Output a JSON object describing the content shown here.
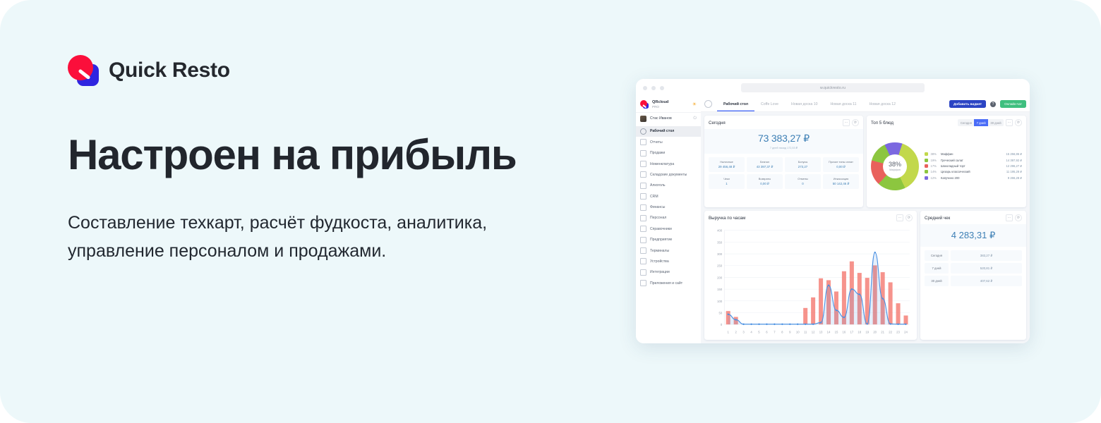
{
  "brand": {
    "name": "Quick Resto"
  },
  "hero": {
    "headline": "Настроен на прибыль",
    "subhead": "Составление техкарт, расчёт фудкоста, аналитика, управление персоналом и продажами."
  },
  "browser": {
    "url": "w.quickresto.ru"
  },
  "app": {
    "sidebar": {
      "brand_name": "QRcloud",
      "brand_plan": "PRO",
      "user": "Стас Иванов",
      "items": [
        {
          "label": "Рабочий стол",
          "icon": "desktop-icon",
          "active": true
        },
        {
          "label": "Отчеты",
          "icon": "report-icon",
          "active": false
        },
        {
          "label": "Продажи",
          "icon": "sales-icon",
          "active": false
        },
        {
          "label": "Номенклатура",
          "icon": "nomenclature-icon",
          "active": false
        },
        {
          "label": "Складские документы",
          "icon": "warehouse-icon",
          "active": false
        },
        {
          "label": "Алкоголь",
          "icon": "alcohol-icon",
          "active": false
        },
        {
          "label": "CRM",
          "icon": "crm-icon",
          "active": false
        },
        {
          "label": "Финансы",
          "icon": "finance-icon",
          "active": false
        },
        {
          "label": "Персонал",
          "icon": "staff-icon",
          "active": false
        },
        {
          "label": "Справочники",
          "icon": "directory-icon",
          "active": false
        },
        {
          "label": "Предприятие",
          "icon": "enterprise-icon",
          "active": false
        },
        {
          "label": "Терминалы",
          "icon": "terminal-icon",
          "active": false
        },
        {
          "label": "Устройства",
          "icon": "device-icon",
          "active": false
        },
        {
          "label": "Интеграции",
          "icon": "integration-icon",
          "active": false
        },
        {
          "label": "Приложения и сайт",
          "icon": "apps-icon",
          "active": false
        }
      ]
    },
    "topbar": {
      "tabs": [
        {
          "label": "Рабочий стол",
          "active": true
        },
        {
          "label": "Coffe Love",
          "active": false
        },
        {
          "label": "Новая доска 10",
          "active": false
        },
        {
          "label": "Новая доска 11",
          "active": false
        },
        {
          "label": "Новая доска 12",
          "active": false
        }
      ],
      "add_widget": "Добавить виджет",
      "help": "?",
      "chat": "Онлайн-чат"
    },
    "today_card": {
      "title": "Сегодня",
      "total": "73 383,27 ₽",
      "compare": "7 дней назад 172,53 ₽",
      "metrics": [
        {
          "label": "Наличные",
          "value": "29 456,48 ₽"
        },
        {
          "label": "Безнал",
          "value": "43 397,37 ₽"
        },
        {
          "label": "Бонусы",
          "value": "273,27"
        },
        {
          "label": "Прочие типы оплат",
          "value": "0,00 ₽"
        },
        {
          "label": "Чеки",
          "value": "1"
        },
        {
          "label": "Возвраты",
          "value": "0,00 ₽"
        },
        {
          "label": "Отмены",
          "value": "0"
        },
        {
          "label": "Инкассация",
          "value": "50 142,46 ₽"
        }
      ]
    },
    "top5_card": {
      "title": "Топ 5 блюд",
      "periods": [
        {
          "label": "Сегодня",
          "active": false
        },
        {
          "label": "7 дней",
          "active": true
        },
        {
          "label": "30 дней",
          "active": false
        }
      ],
      "center_pct": "38%",
      "center_label": "Маффин"
    },
    "revenue_card": {
      "title": "Выручка по часам"
    },
    "avg_card": {
      "title": "Средний чек",
      "total": "4 283,31 ₽",
      "rows": [
        {
          "label": "Сегодня",
          "value": "383,27 ₽"
        },
        {
          "label": "7 дней",
          "value": "520,81 ₽"
        },
        {
          "label": "30 дней",
          "value": "407,62 ₽"
        }
      ]
    }
  },
  "chart_data": [
    {
      "type": "pie",
      "title": "Топ 5 блюд",
      "legend_position": "right",
      "labels": [
        "Маффин",
        "Греческий салат",
        "Шоколадный торт",
        "Цезарь классический",
        "Капучино 200"
      ],
      "values": [
        38,
        19,
        17,
        14,
        12
      ],
      "value_labels": [
        "38%",
        "19%",
        "17%",
        "14%",
        "12%"
      ],
      "amounts": [
        "15 256,86 ₽",
        "14 397,92 ₽",
        "12 296,27 ₽",
        "11 195,28 ₽",
        "9 266,28 ₽"
      ],
      "colors": [
        "#c2d84b",
        "#8cc63f",
        "#e9615c",
        "#8cc63f",
        "#7b68e0"
      ]
    },
    {
      "type": "bar",
      "title": "Выручка по часам",
      "xlabel": "",
      "ylabel": "",
      "ylim": [
        0,
        400
      ],
      "yticks": [
        0,
        50,
        100,
        150,
        200,
        250,
        300,
        350,
        400
      ],
      "grid": true,
      "categories": [
        "1",
        "2",
        "3",
        "4",
        "5",
        "6",
        "7",
        "8",
        "9",
        "10",
        "11",
        "12",
        "13",
        "14",
        "15",
        "16",
        "17",
        "18",
        "19",
        "20",
        "21",
        "22",
        "23",
        "24"
      ],
      "series": [
        {
          "name": "Выручка",
          "type": "bar",
          "color": "#f4756b",
          "values": [
            57,
            32,
            0,
            0,
            0,
            0,
            0,
            0,
            0,
            0,
            70,
            115,
            196,
            188,
            140,
            226,
            268,
            219,
            198,
            251,
            222,
            179,
            90,
            38
          ]
        },
        {
          "name": "Тренд",
          "type": "line",
          "color": "#4a90e2",
          "values": [
            43,
            20,
            1,
            1,
            1,
            1,
            1,
            1,
            1,
            1,
            1,
            1,
            8,
            166,
            60,
            30,
            150,
            128,
            2,
            306,
            110,
            2,
            1,
            1
          ]
        }
      ]
    }
  ]
}
